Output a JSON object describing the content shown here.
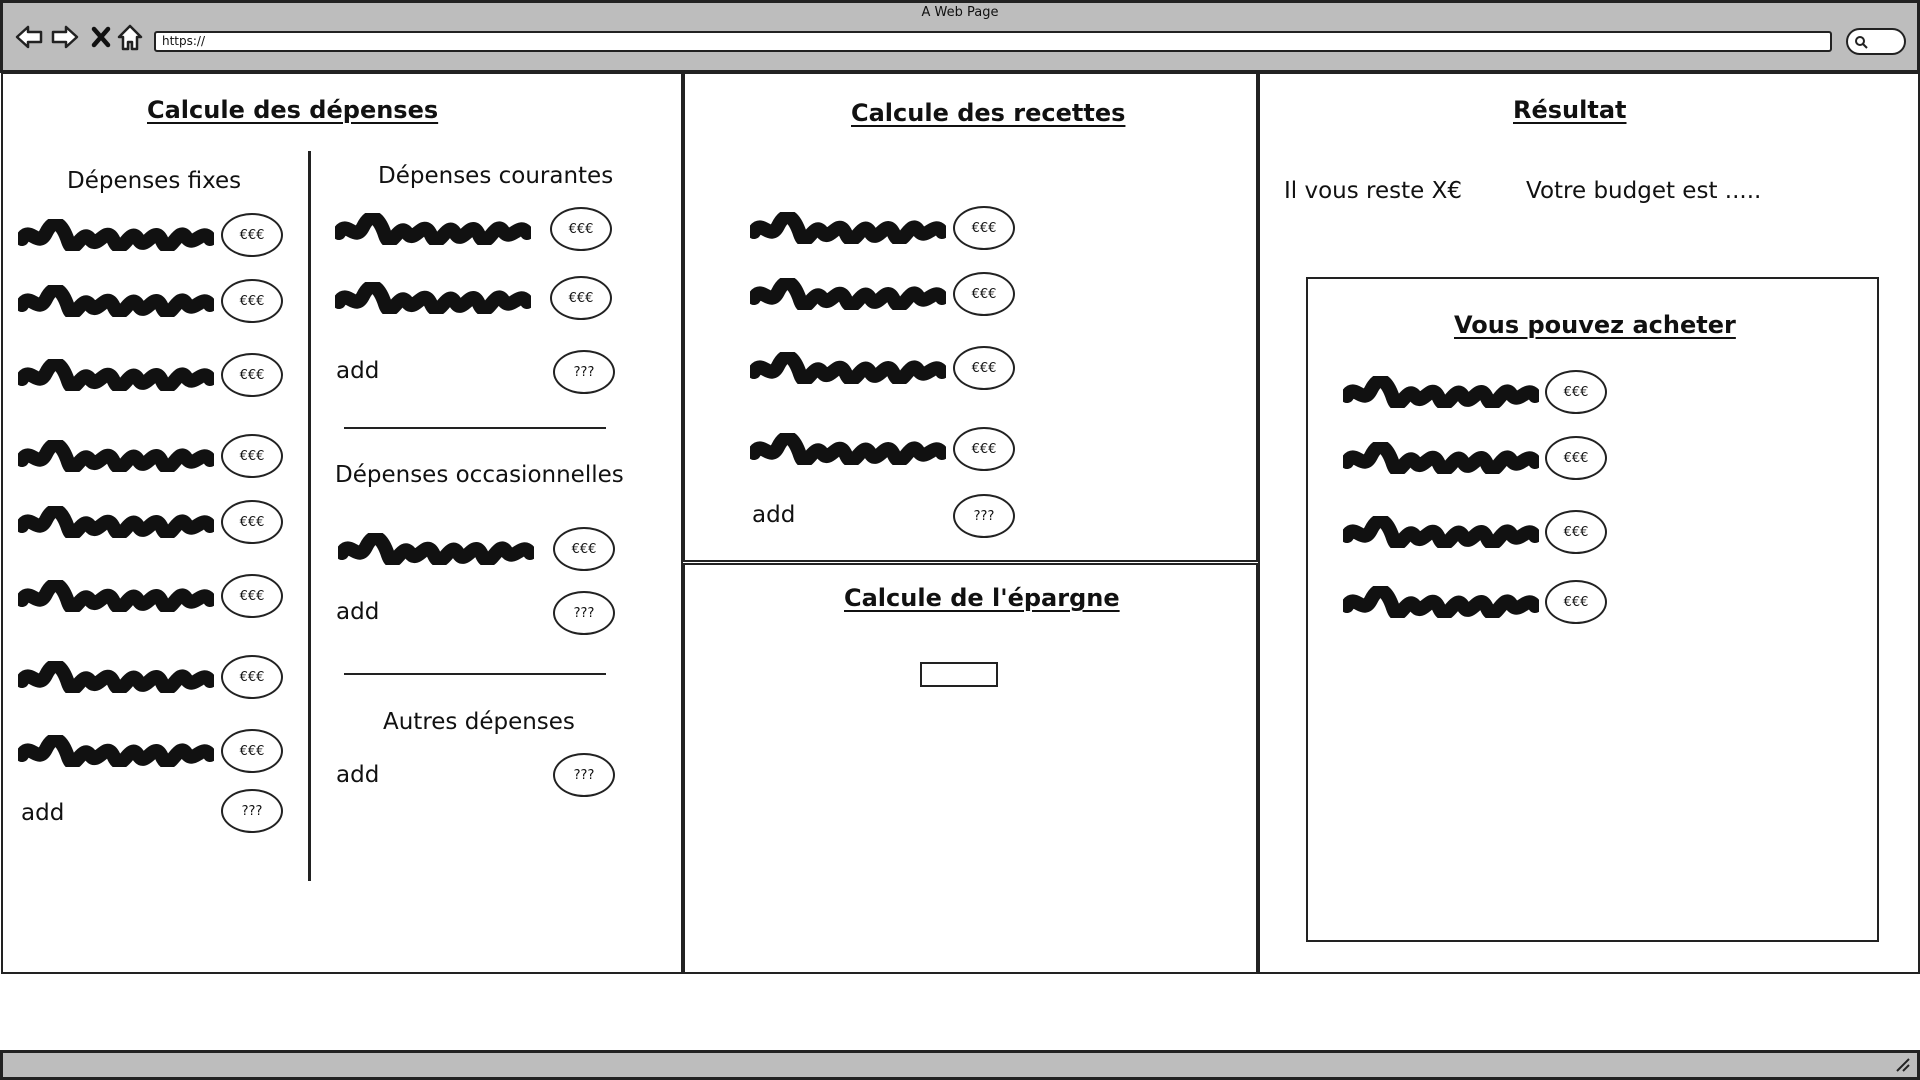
{
  "window": {
    "title": "A Web Page",
    "url": "https://",
    "icons": [
      "back-arrow-icon",
      "forward-arrow-icon",
      "close-x-icon",
      "home-icon",
      "search-icon",
      "resize-grip-icon"
    ]
  },
  "depenses": {
    "title": "Calcule des dépenses",
    "fixes": {
      "heading": "Dépenses fixes",
      "items": [
        "€€€",
        "€€€",
        "€€€",
        "€€€",
        "€€€",
        "€€€",
        "€€€",
        "€€€"
      ],
      "add_label": "add",
      "add_value": "???"
    },
    "courantes": {
      "heading": "Dépenses courantes",
      "items": [
        "€€€",
        "€€€"
      ],
      "add_label": "add",
      "add_value": "???"
    },
    "occasionnelles": {
      "heading": "Dépenses occasionnelles",
      "items": [
        "€€€"
      ],
      "add_label": "add",
      "add_value": "???"
    },
    "autres": {
      "heading": "Autres dépenses",
      "add_label": "add",
      "add_value": "???"
    }
  },
  "recettes": {
    "title": "Calcule des recettes",
    "items": [
      "€€€",
      "€€€",
      "€€€",
      "€€€"
    ],
    "add_label": "add",
    "add_value": "???"
  },
  "epargne": {
    "title": "Calcule de l'épargne",
    "input_value": ""
  },
  "resultat": {
    "title": "Résultat",
    "reste": "Il vous reste X€",
    "budget": "Votre budget est .....",
    "acheter": {
      "title": "Vous pouvez acheter",
      "items": [
        "€€€",
        "€€€",
        "€€€",
        "€€€"
      ]
    }
  }
}
